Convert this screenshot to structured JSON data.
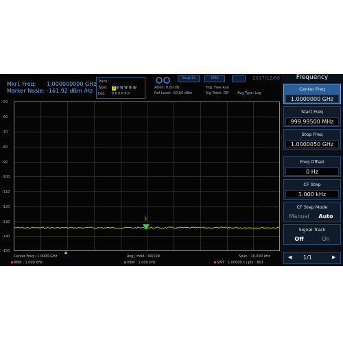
{
  "marker": {
    "freq_label": "Mkr1 Freq:",
    "freq_value": "1.000000000 GHz",
    "noise_label": "Marker Nosie:",
    "noise_value": "-161.92 dBm /Hz"
  },
  "trace_info": {
    "trace_label": "Trace:",
    "trace_numbers": [
      "1",
      "2",
      "3",
      "4",
      "5",
      "6"
    ],
    "type_label": "Type:",
    "type_values": "A W W W W W",
    "det_label": "Det:",
    "det_values": "P P P P P P"
  },
  "header_info": {
    "atten": "Atten: 0.00 dB",
    "ref_level": "Ref Level: -50.00 dBm",
    "trig": "Trig: Free Run",
    "sig_track": "Sig Track: Off",
    "avg_type": "Avg Type: Log",
    "mode_icons": [
      "Swept SA",
      "GPSA"
    ],
    "date": "2017/12/06"
  },
  "panel": {
    "title": "Frequency",
    "center_freq": {
      "label": "Center Freq",
      "value": "1.0000000 GHz"
    },
    "start_freq": {
      "label": "Start Freq",
      "value": "999.99500 MHz"
    },
    "stop_freq": {
      "label": "Stop Freq",
      "value": "1.0000050 GHz"
    },
    "freq_offset": {
      "label": "Freq Offset",
      "value": "0 Hz"
    },
    "cf_step": {
      "label": "CF Step",
      "value": "1.000 kHz"
    },
    "cf_step_mode": {
      "label": "CF Step Mode",
      "manual": "Manual",
      "auto": "Auto"
    },
    "signal_track": {
      "label": "Signal Track",
      "off": "Off",
      "on": "On"
    },
    "page": {
      "prev": "◀",
      "value": "1/1",
      "next": "▶"
    }
  },
  "plot": {
    "y_labels": [
      "-50",
      "-60",
      "-70",
      "-80",
      "-90",
      "-100",
      "-110",
      "-120",
      "-130",
      "-140",
      "-150"
    ],
    "marker_number": "1",
    "trace_color": "#d8d800",
    "marker_color": "#3fd03f"
  },
  "footer": {
    "center_freq": "Center Freq : 1.0000 GHz",
    "avg_hold": "Avg | Hold : 60/100",
    "span": "Span : 10.000 kHz",
    "rbw": "RBW : 1.000 kHz",
    "vbw": "VBW : 1.000 kHz",
    "swt": "SWT : 1.00000 s | pts : 801"
  }
}
